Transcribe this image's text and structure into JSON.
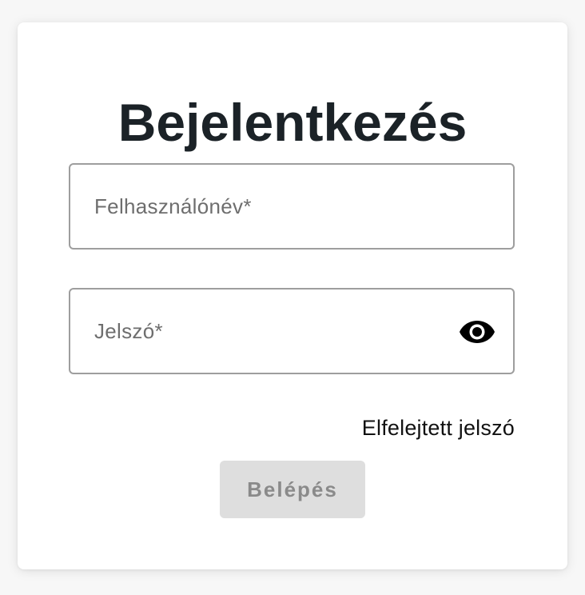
{
  "login": {
    "title": "Bejelentkezés",
    "username_placeholder": "Felhasználónév*",
    "username_value": "",
    "password_placeholder": "Jelszó*",
    "password_value": "",
    "password_toggle_icon": "eye-icon",
    "forgot_password_label": "Elfelejtett jelszó",
    "submit_label": "Belépés",
    "submit_disabled": true
  },
  "colors": {
    "title": "#1b2227",
    "field_border": "#9e9e9e",
    "button_bg_disabled": "#dedede",
    "button_text_disabled": "#8a8a8a",
    "card_bg": "#ffffff",
    "page_bg": "#f7f7f7"
  }
}
